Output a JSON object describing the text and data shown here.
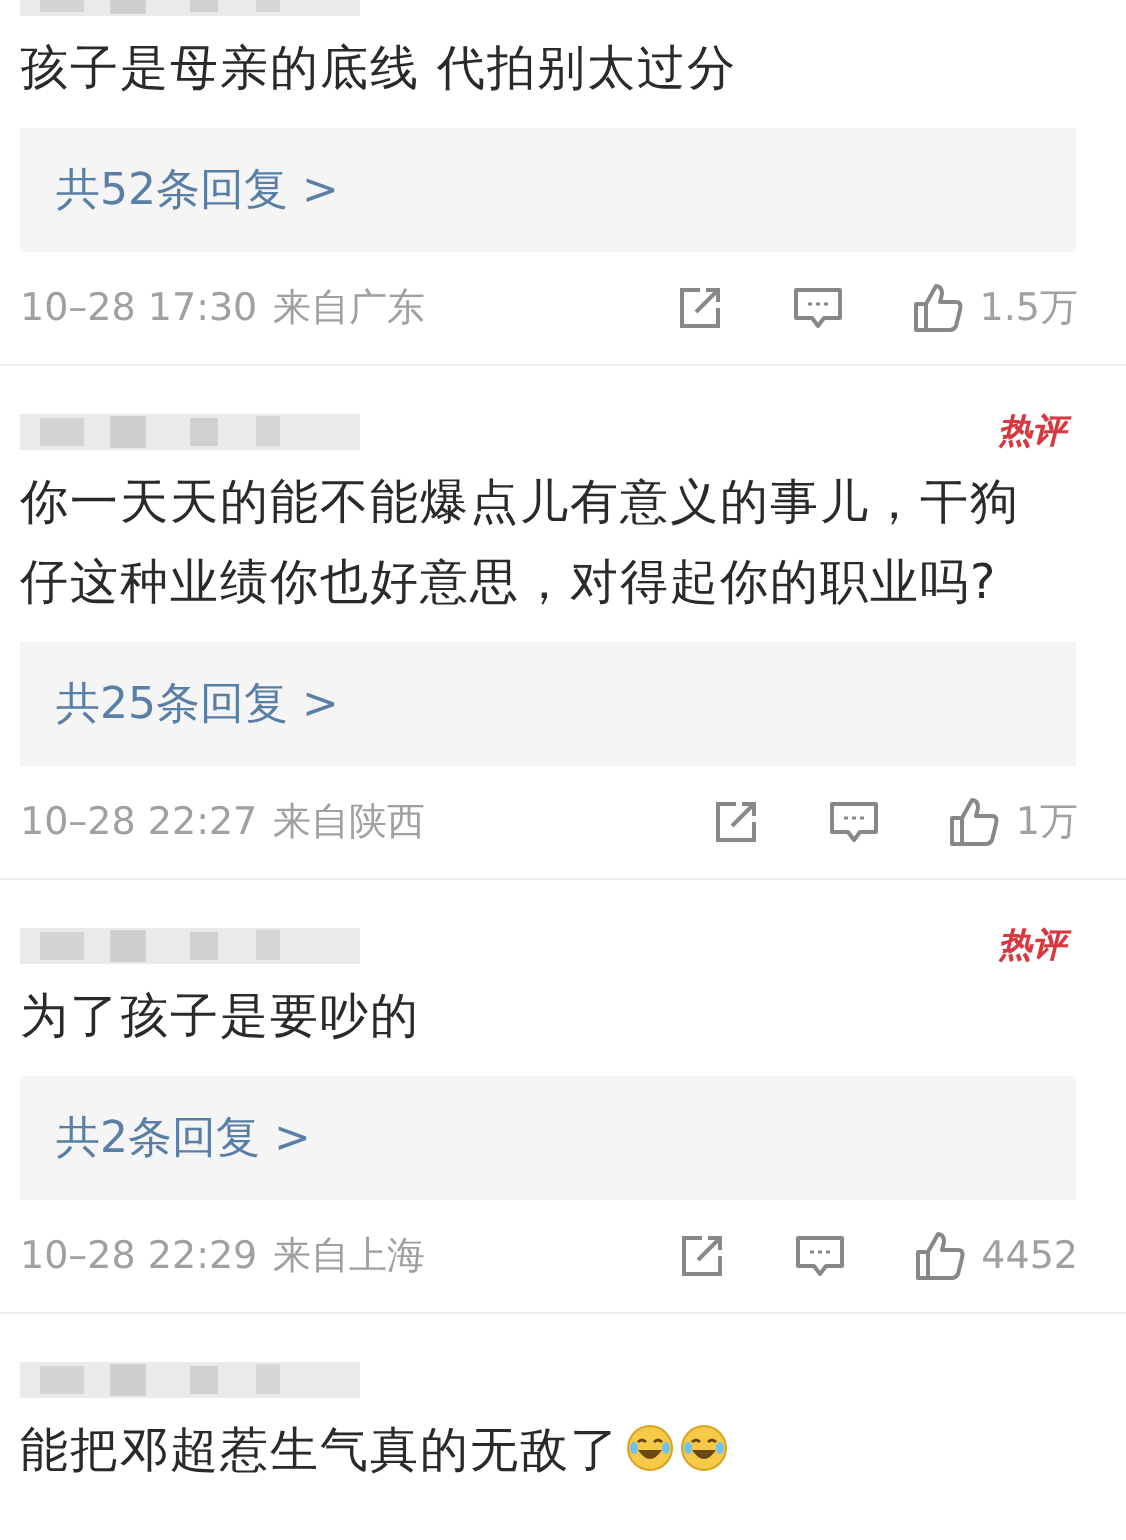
{
  "comments": [
    {
      "kind": "cut_top",
      "text": "孩子是母亲的底线 代拍别太过分",
      "replies": "共52条回复 >",
      "time": "10–28 17:30",
      "location": "来自广东",
      "likes": "1.5万"
    },
    {
      "kind": "full",
      "hot_badge": "热评",
      "text": "你一天天的能不能爆点儿有意义的事儿，干狗仔这种业绩你也好意思，对得起你的职业吗?",
      "replies": "共25条回复 >",
      "time": "10–28 22:27",
      "location": "来自陕西",
      "likes": "1万"
    },
    {
      "kind": "full",
      "hot_badge": "热评",
      "text": "为了孩子是要吵的",
      "replies": "共2条回复 >",
      "time": "10–28 22:29",
      "location": "来自上海",
      "likes": "4452"
    },
    {
      "kind": "full",
      "text": "能把邓超惹生气真的无敌了",
      "emojis": [
        {
          "kind": "laugh"
        },
        {
          "kind": "laugh"
        }
      ]
    }
  ]
}
